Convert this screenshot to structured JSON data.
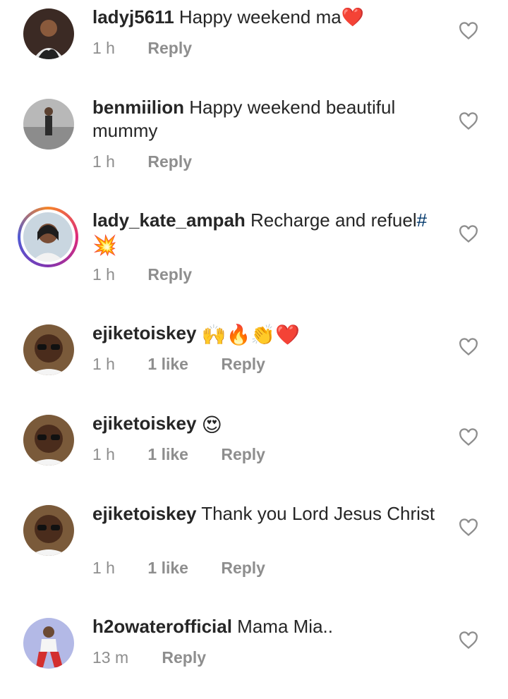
{
  "comments": [
    {
      "username": "ladyj5611",
      "text": "Happy weekend ma❤️",
      "time": "1 h",
      "likes": "",
      "reply": "Reply"
    },
    {
      "username": "benmiilion",
      "text": "Happy weekend beautiful mummy",
      "time": "1 h",
      "likes": "",
      "reply": "Reply"
    },
    {
      "username": "lady_kate_ampah",
      "text": "Recharge and refuel",
      "hashtag": "#",
      "emoji": "💥",
      "time": "1 h",
      "likes": "",
      "reply": "Reply"
    },
    {
      "username": "ejiketoiskey",
      "text": "🙌🔥👏❤️",
      "time": "1 h",
      "likes": "1 like",
      "reply": "Reply"
    },
    {
      "username": "ejiketoiskey",
      "text": "😍",
      "time": "1 h",
      "likes": "1 like",
      "reply": "Reply"
    },
    {
      "username": "ejiketoiskey",
      "text": "Thank you Lord Jesus Christ",
      "time": "1 h",
      "likes": "1 like",
      "reply": "Reply"
    },
    {
      "username": "h2owaterofficial",
      "text": "Mama Mia..",
      "time": "13 m",
      "likes": "",
      "reply": "Reply"
    }
  ],
  "icons": {
    "like": "heart-outline-icon"
  },
  "colors": {
    "text": "#262626",
    "meta": "#8e8e8e",
    "hashtag": "#00376b"
  }
}
